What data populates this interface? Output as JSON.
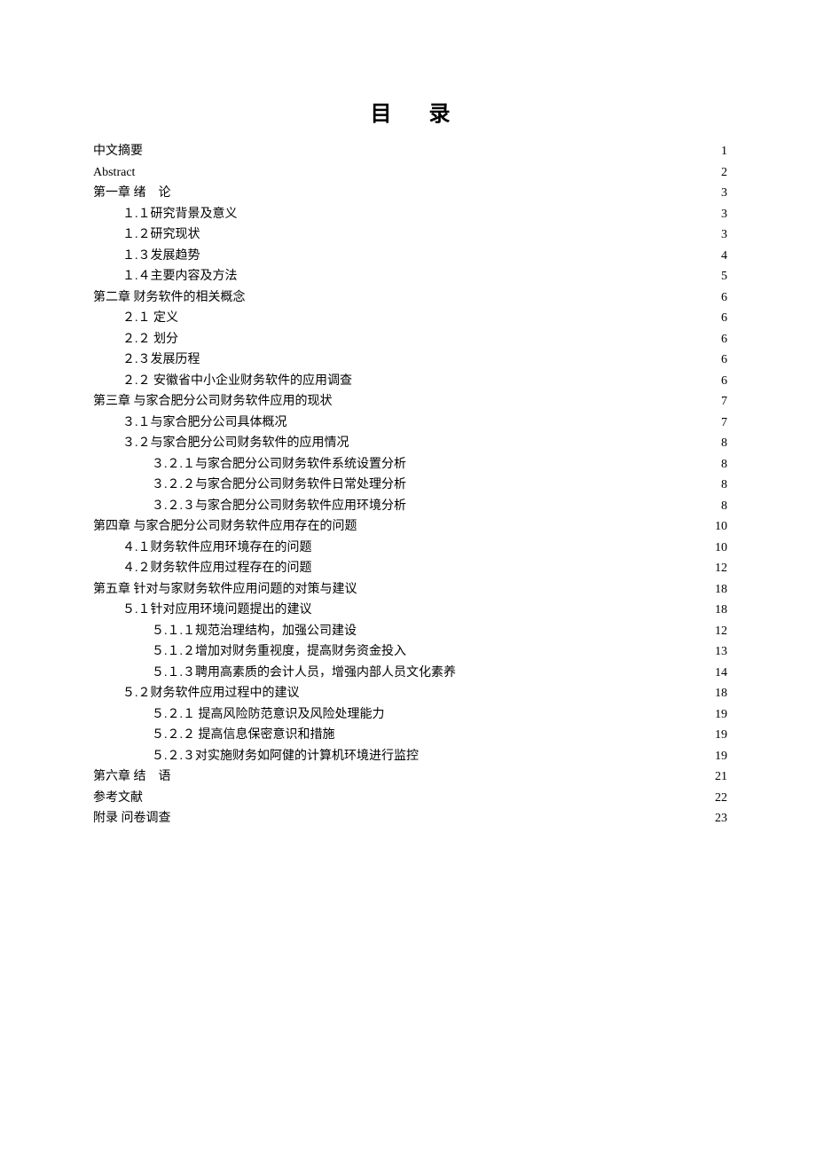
{
  "title": "目 录",
  "entries": [
    {
      "label": "中文摘要",
      "page": "1",
      "level": 0
    },
    {
      "label": "Abstract",
      "page": "2",
      "level": 0
    },
    {
      "label": "第一章 绪　论",
      "page": "3",
      "level": 0
    },
    {
      "label": "１.１研究背景及意义",
      "page": "3",
      "level": 1
    },
    {
      "label": "１.２研究现状",
      "page": "3",
      "level": 1
    },
    {
      "label": "１.３发展趋势",
      "page": "4",
      "level": 1
    },
    {
      "label": "１.４主要内容及方法",
      "page": "5",
      "level": 1
    },
    {
      "label": "第二章 财务软件的相关概念",
      "page": "6",
      "level": 0
    },
    {
      "label": "２.１ 定义",
      "page": "6",
      "level": 1
    },
    {
      "label": "２.２ 划分",
      "page": "6",
      "level": 1
    },
    {
      "label": "２.３发展历程",
      "page": "6",
      "level": 1
    },
    {
      "label": "２.２ 安徽省中小企业财务软件的应用调查",
      "page": "6",
      "level": 1
    },
    {
      "label": "第三章 与家合肥分公司财务软件应用的现状",
      "page": "7",
      "level": 0
    },
    {
      "label": "３.１与家合肥分公司具体概况",
      "page": "7",
      "level": 1
    },
    {
      "label": "３.２与家合肥分公司财务软件的应用情况",
      "page": "8",
      "level": 1
    },
    {
      "label": "３.２.１与家合肥分公司财务软件系统设置分析",
      "page": "8",
      "level": 2
    },
    {
      "label": "３.２.２与家合肥分公司财务软件日常处理分析",
      "page": "8",
      "level": 2
    },
    {
      "label": "３.２.３与家合肥分公司财务软件应用环境分析",
      "page": "8",
      "level": 2
    },
    {
      "label": "第四章 与家合肥分公司财务软件应用存在的问题",
      "page": "10",
      "level": 0
    },
    {
      "label": "４.１财务软件应用环境存在的问题",
      "page": "10",
      "level": 1
    },
    {
      "label": "４.２财务软件应用过程存在的问题",
      "page": "12",
      "level": 1
    },
    {
      "label": "第五章 针对与家财务软件应用问题的对策与建议",
      "page": "18",
      "level": 0
    },
    {
      "label": "５.１针对应用环境问题提出的建议",
      "page": "18",
      "level": 1
    },
    {
      "label": "５.１.１规范治理结构，加强公司建设",
      "page": "12",
      "level": 2
    },
    {
      "label": "５.１.２增加对财务重视度，提高财务资金投入",
      "page": "13",
      "level": 2
    },
    {
      "label": "５.１.３聘用高素质的会计人员，增强内部人员文化素养",
      "page": "14",
      "level": 2
    },
    {
      "label": "５.２财务软件应用过程中的建议",
      "page": "18",
      "level": 1
    },
    {
      "label": "５.２.１ 提高风险防范意识及风险处理能力",
      "page": "19",
      "level": 2
    },
    {
      "label": "５.２.２ 提高信息保密意识和措施",
      "page": "19",
      "level": 2
    },
    {
      "label": "５.２.３对实施财务如阿健的计算机环境进行监控",
      "page": "19",
      "level": 2
    },
    {
      "label": "第六章 结　语",
      "page": "21",
      "level": 0
    },
    {
      "label": "参考文献",
      "page": "22",
      "level": 0
    },
    {
      "label": "附录 问卷调查",
      "page": "23",
      "level": 0
    }
  ]
}
